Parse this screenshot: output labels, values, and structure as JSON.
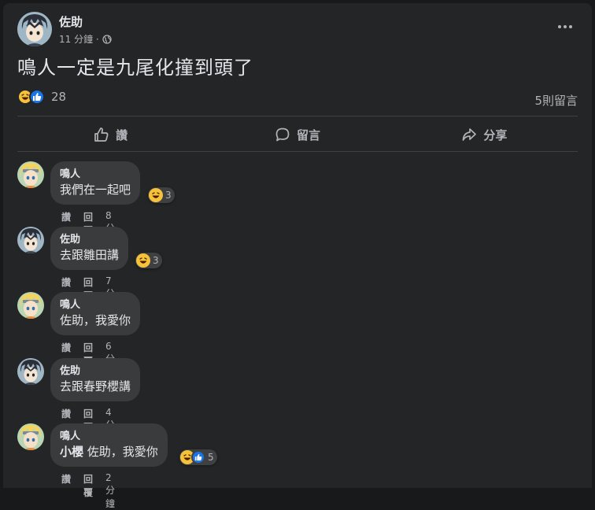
{
  "post": {
    "author": "佐助",
    "time": "11 分鐘 ·",
    "privacy_icon": "globe-icon",
    "text": "鳴人一定是九尾化撞到頭了",
    "reaction_count": "28",
    "comment_count": "5則留言"
  },
  "actions": {
    "like": "讚",
    "comment": "留言",
    "share": "分享"
  },
  "comments": [
    {
      "name": "鳴人",
      "text": "我們在一起吧",
      "mention": "",
      "reactions": "3",
      "reaction_types": [
        "haha"
      ],
      "like": "讚",
      "reply": "回覆",
      "time": "8分鐘",
      "avatar": "naruto"
    },
    {
      "name": "佐助",
      "text": "去跟雛田講",
      "mention": "",
      "reactions": "3",
      "reaction_types": [
        "haha"
      ],
      "like": "讚",
      "reply": "回覆",
      "time": "7分鐘",
      "avatar": "sasuke"
    },
    {
      "name": "鳴人",
      "text": "佐助，我愛你",
      "mention": "",
      "reactions": "",
      "reaction_types": [],
      "like": "讚",
      "reply": "回覆",
      "time": "6分鐘",
      "avatar": "naruto"
    },
    {
      "name": "佐助",
      "text": "去跟春野櫻講",
      "mention": "",
      "reactions": "",
      "reaction_types": [],
      "like": "讚",
      "reply": "回覆",
      "time": "4分鐘",
      "avatar": "sasuke"
    },
    {
      "name": "鳴人",
      "text": " 佐助，我愛你",
      "mention": "小櫻",
      "reactions": "5",
      "reaction_types": [
        "haha",
        "like"
      ],
      "like": "讚",
      "reply": "回覆",
      "time": "2分鐘",
      "avatar": "naruto"
    }
  ],
  "colors": {
    "background": "#18191a",
    "card": "#242526",
    "bubble": "#3a3b3c",
    "text_primary": "#e4e6eb",
    "text_secondary": "#b0b3b8",
    "like_blue": "#1b74e4",
    "haha_yellow": "#f7c23b"
  }
}
